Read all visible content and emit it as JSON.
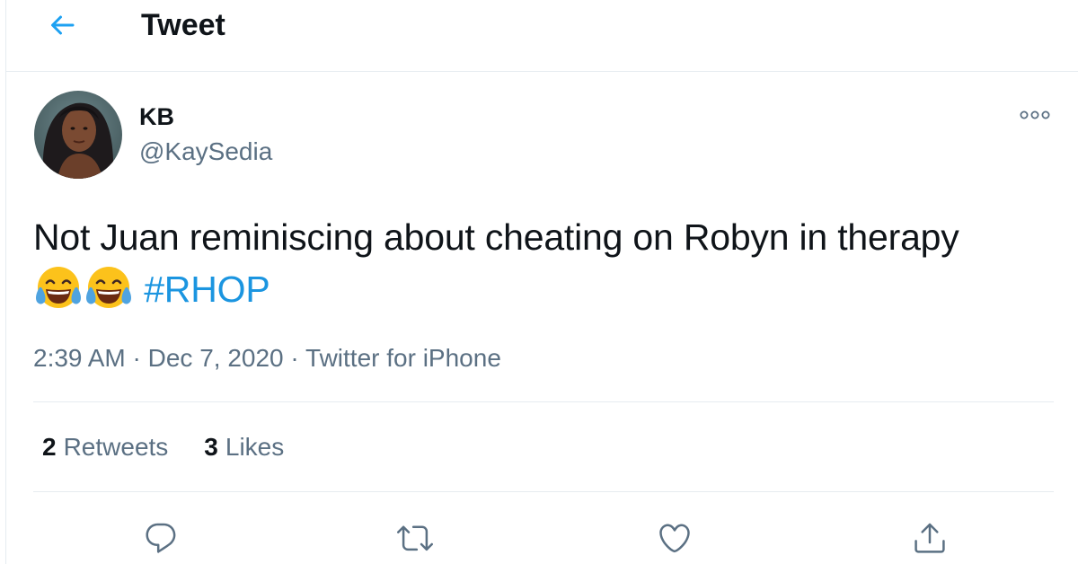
{
  "header": {
    "title": "Tweet",
    "back_icon": "arrow-left-icon"
  },
  "tweet": {
    "author": {
      "name": "KB",
      "handle": "@KaySedia"
    },
    "text": "Not Juan reminiscing about cheating on Robyn in therapy",
    "emojis": [
      "😂",
      "😂"
    ],
    "hashtag": "#RHOP",
    "time": "2:39 AM",
    "separator": "·",
    "date": "Dec 7, 2020",
    "source": "Twitter for iPhone",
    "stats": {
      "retweets_count": "2",
      "retweets_label": "Retweets",
      "likes_count": "3",
      "likes_label": "Likes"
    }
  },
  "actions": [
    {
      "name": "reply",
      "icon": "reply-icon"
    },
    {
      "name": "retweet",
      "icon": "retweet-icon"
    },
    {
      "name": "like",
      "icon": "heart-icon"
    },
    {
      "name": "share",
      "icon": "share-icon"
    }
  ],
  "colors": {
    "accent": "#1da1f2",
    "hashtag": "#1b95e0",
    "secondary_text": "#5b7083",
    "primary_text": "#0f1419",
    "divider": "#e6ecf0"
  }
}
